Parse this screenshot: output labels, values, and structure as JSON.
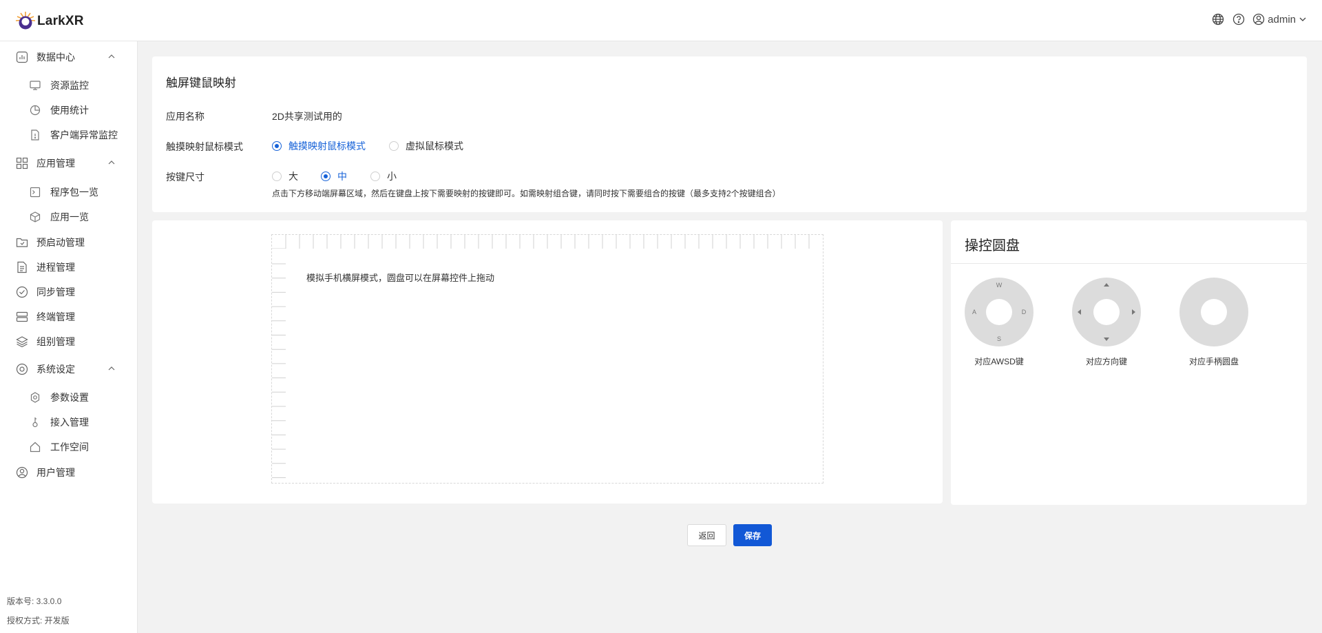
{
  "header": {
    "logo_text": "LarkXR",
    "user_name": "admin"
  },
  "sidebar": {
    "groups": [
      {
        "label": "数据中心",
        "items": [
          "资源监控",
          "使用统计",
          "客户端异常监控"
        ]
      },
      {
        "label": "应用管理",
        "items": [
          "程序包一览",
          "应用一览"
        ]
      },
      {
        "label": "预启动管理"
      },
      {
        "label": "进程管理"
      },
      {
        "label": "同步管理"
      },
      {
        "label": "终端管理"
      },
      {
        "label": "组别管理"
      },
      {
        "label": "系统设定",
        "items": [
          "参数设置",
          "接入管理",
          "工作空间"
        ]
      },
      {
        "label": "用户管理"
      }
    ],
    "version": "版本号: 3.3.0.0",
    "license": "授权方式: 开发版"
  },
  "form": {
    "title": "触屏键鼠映射",
    "app_name_label": "应用名称",
    "app_name_value": "2D共享测试用的",
    "mouse_mode_label": "触摸映射鼠标模式",
    "mouse_mode_options": [
      "触摸映射鼠标模式",
      "虚拟鼠标模式"
    ],
    "mouse_mode_selected": "触摸映射鼠标模式",
    "key_size_label": "按键尺寸",
    "key_size_options": [
      "大",
      "中",
      "小"
    ],
    "key_size_selected": "中",
    "hint": "点击下方移动端屏幕区域，然后在键盘上按下需要映射的按键即可。如需映射组合键，请同时按下需要组合的按键（最多支持2个按键组合）"
  },
  "screen": {
    "text": "模拟手机横屏模式，圆盘可以在屏幕控件上拖动"
  },
  "pads": {
    "title": "操控圆盘",
    "wasd_letters": [
      "W",
      "A",
      "S",
      "D"
    ],
    "items": [
      {
        "label": "对应AWSD键"
      },
      {
        "label": "对应方向键"
      },
      {
        "label": "对应手柄圆盘"
      }
    ]
  },
  "actions": {
    "back_label": "返回",
    "save_label": "保存"
  },
  "colors": {
    "primary": "#1662d8",
    "pad_gray": "#dcdcdc"
  }
}
